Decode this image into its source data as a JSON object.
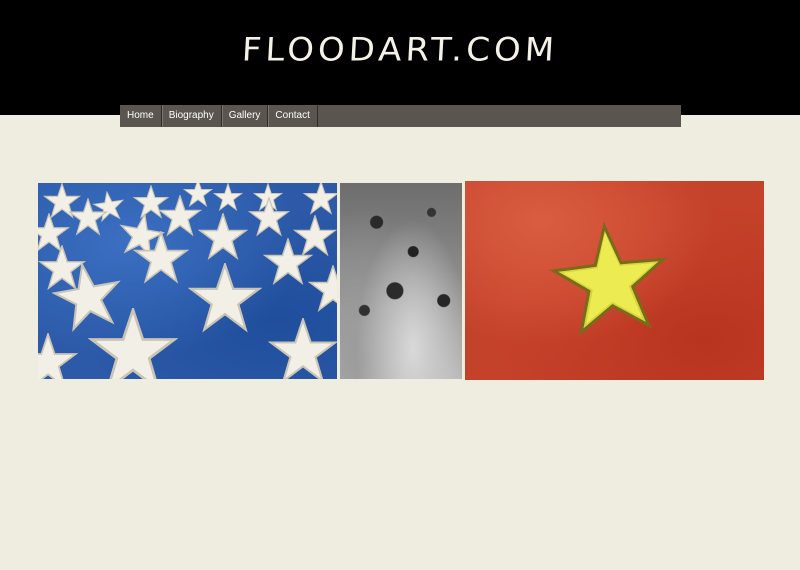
{
  "site": {
    "logo": "FLOODART.COM"
  },
  "nav": {
    "items": [
      {
        "label": "Home"
      },
      {
        "label": "Biography"
      },
      {
        "label": "Gallery"
      },
      {
        "label": "Contact"
      }
    ]
  },
  "colors": {
    "page_background": "#eeede0",
    "header_background": "#000000",
    "navbar_background": "#5a554e",
    "logo_text": "#f4f1e6"
  },
  "gallery": {
    "photos": [
      {
        "subject": "white stars on blue"
      },
      {
        "subject": "grey textured surface"
      },
      {
        "subject": "yellow star on red"
      }
    ]
  }
}
